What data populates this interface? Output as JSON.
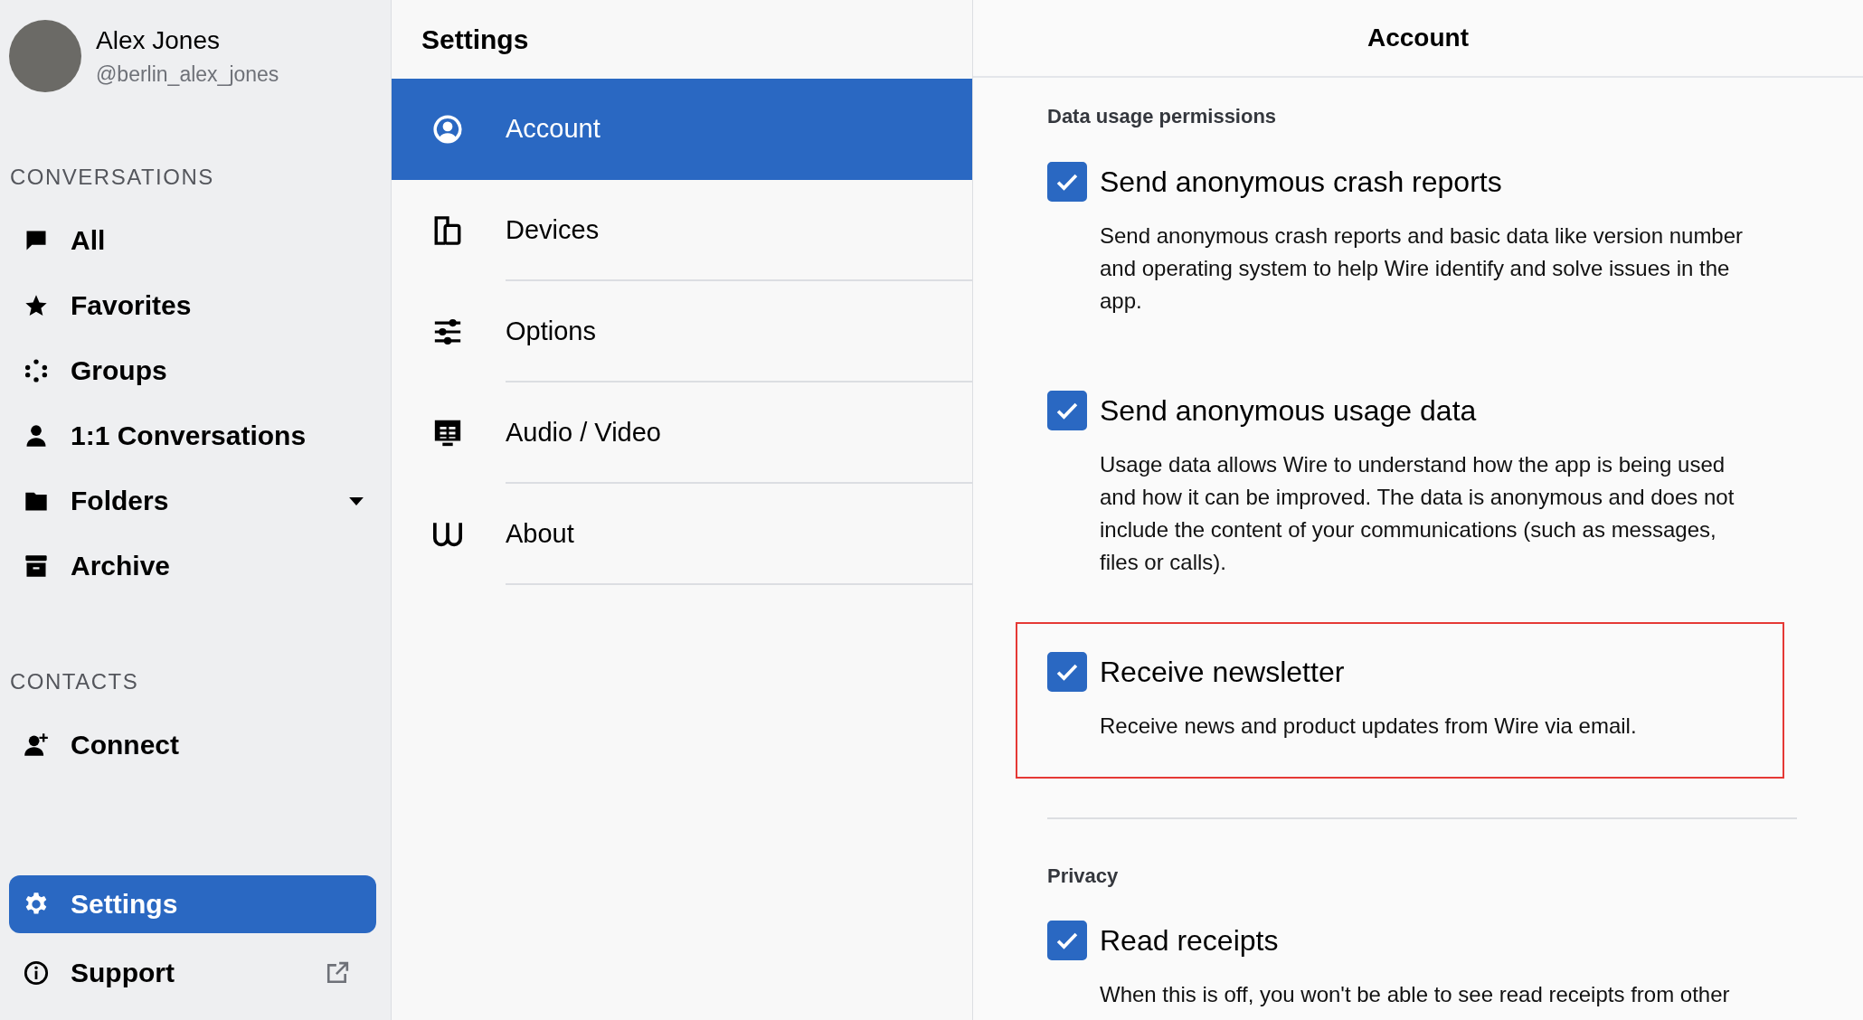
{
  "profile": {
    "name": "Alex Jones",
    "handle": "@berlin_alex_jones"
  },
  "sidebar": {
    "sections": [
      {
        "title": "CONVERSATIONS",
        "items": [
          {
            "label": "All",
            "selected": false
          },
          {
            "label": "Favorites",
            "selected": false
          },
          {
            "label": "Groups",
            "selected": false
          },
          {
            "label": "1:1 Conversations",
            "selected": false
          },
          {
            "label": "Folders",
            "selected": false,
            "expandable": true
          },
          {
            "label": "Archive",
            "selected": false
          }
        ]
      },
      {
        "title": "CONTACTS",
        "items": [
          {
            "label": "Connect",
            "selected": false
          }
        ]
      }
    ],
    "footer": [
      {
        "label": "Settings",
        "selected": true
      },
      {
        "label": "Support",
        "selected": false,
        "external": true
      }
    ]
  },
  "settings_menu": {
    "title": "Settings",
    "items": [
      {
        "label": "Account",
        "selected": true
      },
      {
        "label": "Devices",
        "selected": false
      },
      {
        "label": "Options",
        "selected": false
      },
      {
        "label": "Audio / Video",
        "selected": false
      },
      {
        "label": "About",
        "selected": false
      }
    ]
  },
  "panel": {
    "title": "Account",
    "sections": [
      {
        "title": "Data usage permissions",
        "items": [
          {
            "label": "Send anonymous crash reports",
            "description": "Send anonymous crash reports and basic data like version number and operating system to help Wire identify and solve issues in the app.",
            "checked": true,
            "highlighted": false
          },
          {
            "label": "Send anonymous usage data",
            "description": "Usage data allows Wire to understand how the app is being used and how it can be improved. The data is anonymous and does not include the content of your communications (such as messages, files or calls).",
            "checked": true,
            "highlighted": false
          },
          {
            "label": "Receive newsletter",
            "description": "Receive news and product updates from Wire via email.",
            "checked": true,
            "highlighted": true
          }
        ]
      },
      {
        "title": "Privacy",
        "items": [
          {
            "label": "Read receipts",
            "description": "When this is off, you won't be able to see read receipts from other",
            "checked": true,
            "highlighted": false
          }
        ]
      }
    ]
  }
}
